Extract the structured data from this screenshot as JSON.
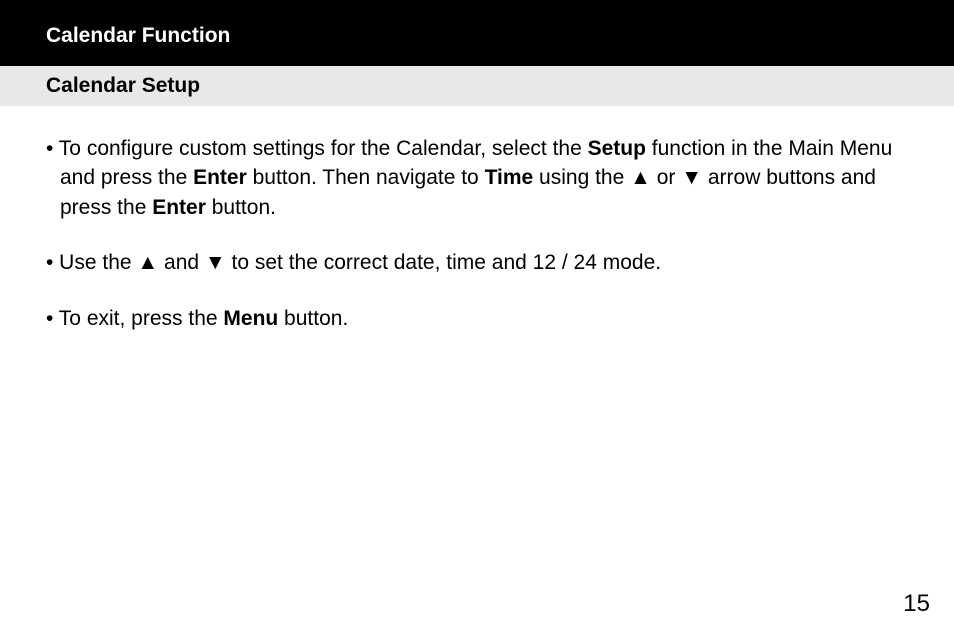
{
  "header": {
    "title": "Calendar Function"
  },
  "subtitle": "Calendar Setup",
  "bullets": {
    "b1_pre": "• To configure custom settings for the Calendar, select the ",
    "b1_bold1": "Setup",
    "b1_mid1": " function in the Main Menu and press the ",
    "b1_bold2": "Enter",
    "b1_mid2": " button.  Then navigate to ",
    "b1_bold3": "Time",
    "b1_mid3": " using the ▲ or ▼ arrow buttons and press the ",
    "b1_bold4": "Enter",
    "b1_post": " button.",
    "b2": "• Use the ▲ and ▼ to set the correct date, time and 12 / 24 mode.",
    "b3_pre": "• To exit, press the ",
    "b3_bold": "Menu",
    "b3_post": " button."
  },
  "page_number": "15"
}
